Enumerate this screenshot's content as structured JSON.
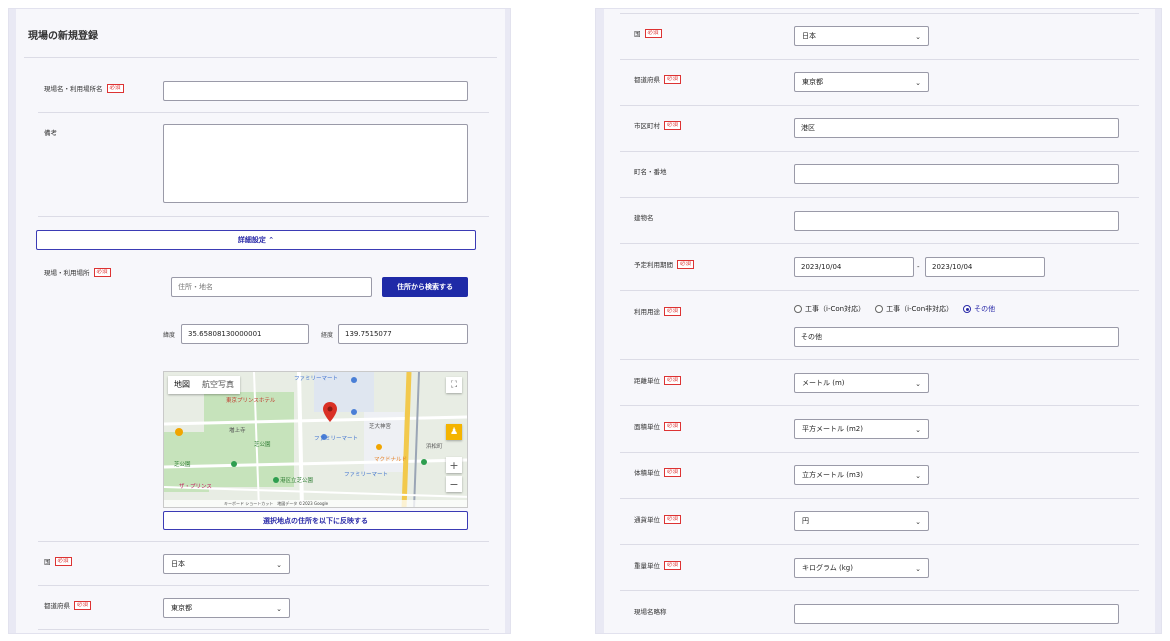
{
  "left": {
    "title": "現場の新規登録",
    "site_name": {
      "label": "現場名・利用場所名",
      "required": "必須",
      "value": ""
    },
    "notes": {
      "label": "備考"
    },
    "details_button": "詳細設定 ⌃",
    "location": {
      "label": "現場・利用場所",
      "required": "必須",
      "search_placeholder": "住所・地名",
      "search_button": "住所から検索する",
      "lat_label": "緯度",
      "lat_value": "35.65808130000001",
      "lng_label": "経度",
      "lng_value": "139.7515077",
      "map_tab_map": "地図",
      "map_tab_satellite": "航空写真",
      "map_footer": "キーボード ショートカット　地図データ ©2023 Google",
      "map_labels": {
        "a": "ファミリーマート",
        "b": "東京プリンスホテル",
        "c": "芝公園",
        "d": "芝大神宮",
        "e": "マクドナルド",
        "f": "浜松町",
        "g": "ファミリーマート",
        "h": "芝公園",
        "i": "港区立芝公園",
        "j": "ザ・プリンス",
        "k": "増上寺",
        "l": "ファミリーマート"
      },
      "reflect_button": "選択地点の住所を以下に反映する"
    },
    "country": {
      "label": "国",
      "required": "必須",
      "value": "日本"
    },
    "prefecture": {
      "label": "都道府県",
      "required": "必須",
      "value": "東京都"
    }
  },
  "right": {
    "country": {
      "label": "国",
      "required": "必須",
      "value": "日本"
    },
    "prefecture": {
      "label": "都道府県",
      "required": "必須",
      "value": "東京都"
    },
    "city": {
      "label": "市区町村",
      "required": "必須",
      "value": "港区"
    },
    "street": {
      "label": "町名・番地",
      "value": ""
    },
    "building": {
      "label": "建物名",
      "value": ""
    },
    "period": {
      "label": "予定利用期間",
      "required": "必須",
      "start": "2023/10/04",
      "separator": "-",
      "end": "2023/10/04"
    },
    "purpose": {
      "label": "利用用途",
      "required": "必須",
      "options": [
        "工事（i-Con対応）",
        "工事（i-Con非対応）",
        "その他"
      ],
      "selected": "その他",
      "other_value": "その他"
    },
    "distance_unit": {
      "label": "距離単位",
      "required": "必須",
      "value": "メートル (m)"
    },
    "area_unit": {
      "label": "面積単位",
      "required": "必須",
      "value": "平方メートル (m2)"
    },
    "volume_unit": {
      "label": "体積単位",
      "required": "必須",
      "value": "立方メートル (m3)"
    },
    "currency_unit": {
      "label": "通貨単位",
      "required": "必須",
      "value": "円"
    },
    "weight_unit": {
      "label": "重量単位",
      "required": "必須",
      "value": "キログラム (kg)"
    },
    "short_name": {
      "label": "現場名略称",
      "value": ""
    }
  },
  "colors": {
    "accent": "#1f2aa7",
    "required": "#d33333",
    "panel_bg": "#f7f7fb"
  }
}
